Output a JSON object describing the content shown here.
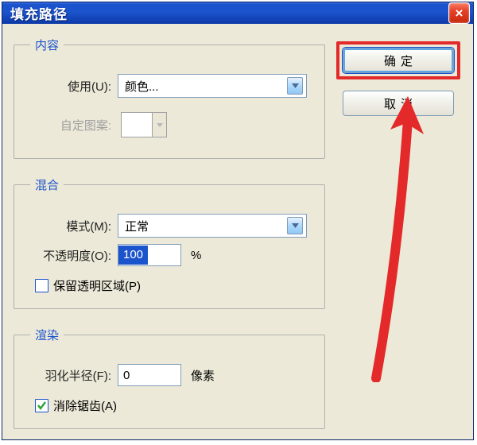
{
  "title": "填充路径",
  "close_icon": "×",
  "buttons": {
    "ok": "确定",
    "cancel": "取消"
  },
  "groups": {
    "content": {
      "legend": "内容",
      "use_label": "使用(U):",
      "use_value": "颜色...",
      "pattern_label": "自定图案:"
    },
    "blend": {
      "legend": "混合",
      "mode_label": "模式(M):",
      "mode_value": "正常",
      "opacity_label": "不透明度(O):",
      "opacity_value": "100",
      "opacity_suffix": "%",
      "preserve_label": "保留透明区域(P)",
      "preserve_checked": false
    },
    "render": {
      "legend": "渲染",
      "feather_label": "羽化半径(F):",
      "feather_value": "0",
      "feather_suffix": "像素",
      "antialias_label": "消除锯齿(A)",
      "antialias_checked": true
    }
  }
}
